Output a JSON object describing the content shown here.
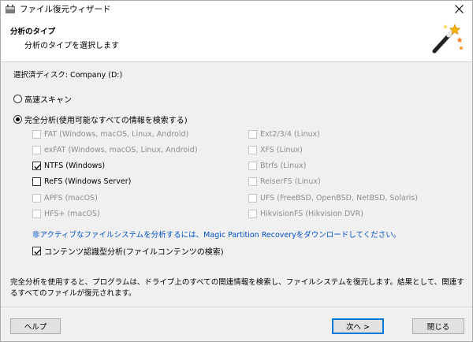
{
  "window": {
    "title": "ファイル復元ウィザード"
  },
  "header": {
    "title": "分析のタイプ",
    "subtitle": "分析のタイプを選択します"
  },
  "disk": {
    "label": "選択済ディスク: Company (D:)"
  },
  "options": {
    "fast_scan": {
      "label": "高速スキャン",
      "selected": false
    },
    "full_analysis": {
      "label": "完全分析(使用可能なすべての情報を検索する)",
      "selected": true
    }
  },
  "filesystems_left": [
    {
      "label": "FAT (Windows, macOS, Linux, Android)",
      "checked": false,
      "enabled": false
    },
    {
      "label": "exFAT (Windows, macOS, Linux, Android)",
      "checked": false,
      "enabled": false
    },
    {
      "label": "NTFS (Windows)",
      "checked": true,
      "enabled": true
    },
    {
      "label": "ReFS (Windows Server)",
      "checked": false,
      "enabled": true
    },
    {
      "label": "APFS (macOS)",
      "checked": false,
      "enabled": false
    },
    {
      "label": "HFS+ (macOS)",
      "checked": false,
      "enabled": false
    }
  ],
  "filesystems_right": [
    {
      "label": "Ext2/3/4 (Linux)",
      "checked": false,
      "enabled": false
    },
    {
      "label": "XFS (Linux)",
      "checked": false,
      "enabled": false
    },
    {
      "label": "Btrfs (Linux)",
      "checked": false,
      "enabled": false
    },
    {
      "label": "ReiserFS (Linux)",
      "checked": false,
      "enabled": false
    },
    {
      "label": "UFS (FreeBSD, OpenBSD, NetBSD, Solaris)",
      "checked": false,
      "enabled": false
    },
    {
      "label": "HikvisionFS (Hikvision DVR)",
      "checked": false,
      "enabled": false
    }
  ],
  "download_link": "非アクティブなファイルシステムを分析するには、Magic Partition Recoveryをダウンロードしてください。",
  "content_analysis": {
    "label": "コンテンツ認識型分析(ファイルコンテンツの検索)",
    "checked": true
  },
  "summary": "完全分析を使用すると、プログラムは、ドライブ上のすべての関連情報を検索し、ファイルシステムを復元します。結果として、関連するすべてのファイルが復元されます。",
  "buttons": {
    "help": "ヘルプ",
    "next": "次へ >",
    "close": "閉じる"
  },
  "colors": {
    "link": "#0050c8",
    "disabled_text": "#8d8d8d",
    "accent": "#0078d7"
  }
}
